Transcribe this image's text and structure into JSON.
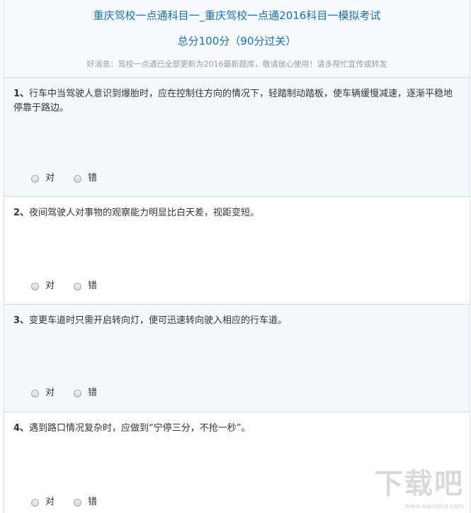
{
  "header": {
    "title": "重庆驾校一点通科目一_重庆驾校一点通2016科目一模拟考试",
    "score": "总分100分（90分过关）",
    "notice": "好消息：驾校一点通已全部更新为2016最新题库，敬请放心使用！请多帮忙宣传或转发"
  },
  "questions": [
    {
      "number": "1、",
      "text": "行车中当驾驶人意识到爆胎时，应在控制住方向的情况下，轻踏制动踏板，使车辆缓慢减速，逐渐平稳地停靠于路边。",
      "options": [
        "对",
        "错"
      ]
    },
    {
      "number": "2、",
      "text": "夜间驾驶人对事物的观察能力明显比白天差，视距变短。",
      "options": [
        "对",
        "错"
      ]
    },
    {
      "number": "3、",
      "text": "变更车道时只需开启转向灯，便可迅速转向驶入相应的行车道。",
      "options": [
        "对",
        "错"
      ]
    },
    {
      "number": "4、",
      "text": "遇到路口情况复杂时，应做到“宁停三分，不抢一秒”。",
      "options": [
        "对",
        "错"
      ]
    }
  ],
  "watermark": {
    "logo_text": "下载吧",
    "url": "www.xiazaiba.com"
  }
}
